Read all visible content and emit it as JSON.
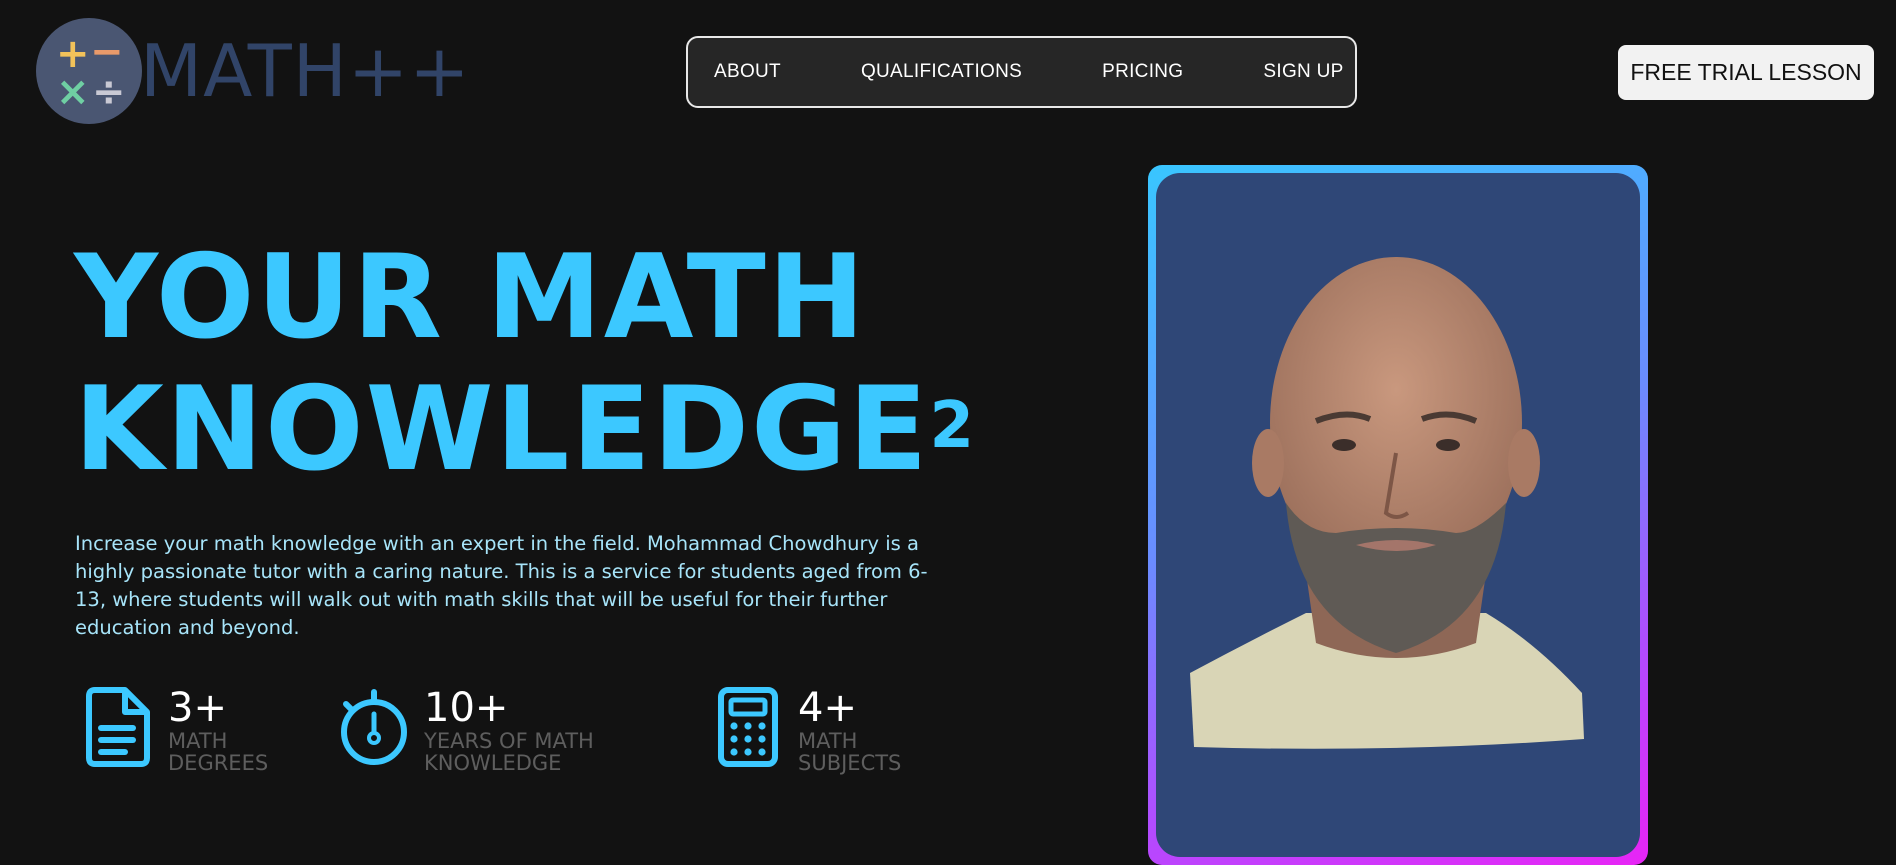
{
  "logo": {
    "text": "MATH++",
    "symbols": [
      "+",
      "−",
      "×",
      "÷"
    ]
  },
  "nav": {
    "links": [
      "ABOUT",
      "QUALIFICATIONS",
      "PRICING",
      "SIGN UP"
    ]
  },
  "cta": {
    "label": "FREE TRIAL LESSON"
  },
  "hero": {
    "title_line1": "YOUR MATH",
    "title_line2": "KNOWLEDGE",
    "title_superscript": "2",
    "description": "Increase your math knowledge with an expert in the field. Mohammad Chowdhury is a highly passionate tutor with a caring nature. This is a service for students aged from 6-13, where students will walk out with math skills that will be useful for their further education and beyond."
  },
  "stats": [
    {
      "icon": "document-icon",
      "value": "3+",
      "label": "MATH\nDEGREES"
    },
    {
      "icon": "stopwatch-icon",
      "value": "10+",
      "label": "YEARS OF MATH\nKNOWLEDGE"
    },
    {
      "icon": "calculator-icon",
      "value": "4+",
      "label": "MATH\nSUBJECTS"
    }
  ],
  "colors": {
    "accent": "#3cc8ff",
    "background": "#121212",
    "logo_text": "#314468",
    "portrait_bg": "#2f4777"
  }
}
